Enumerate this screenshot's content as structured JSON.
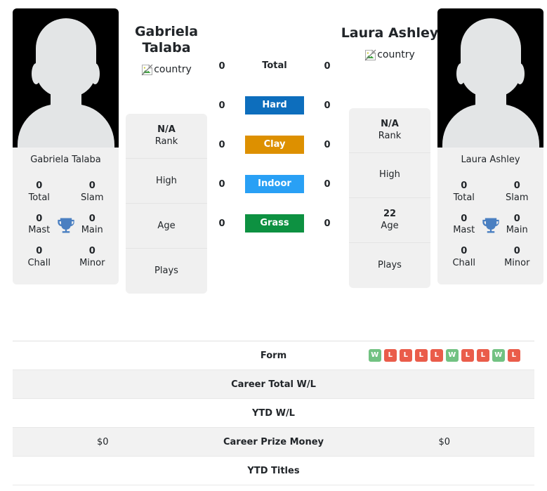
{
  "colors": {
    "hard": "#0d6ebd",
    "clay": "#dd9000",
    "indoor": "#29a0f5",
    "grass": "#0d9141",
    "win": "#72c282",
    "loss": "#ea5c4a",
    "trophy": "#4a7fc1",
    "card_bg": "#f0f0f0",
    "row_alt": "#f2f2f2"
  },
  "players": {
    "left": {
      "name_lines": [
        "Gabriela",
        "Talaba"
      ],
      "photo_caption": "Gabriela Talaba",
      "country_alt": "country",
      "titles": [
        {
          "value": "0",
          "label": "Total"
        },
        {
          "value": "0",
          "label": "Slam"
        },
        {
          "value": "0",
          "label": "Mast"
        },
        {
          "value": "0",
          "label": "Main"
        },
        {
          "value": "0",
          "label": "Chall"
        },
        {
          "value": "0",
          "label": "Minor"
        }
      ],
      "info": [
        {
          "value": "N/A",
          "label": "Rank"
        },
        {
          "value": "",
          "label": "High"
        },
        {
          "value": "",
          "label": "Age"
        },
        {
          "value": "",
          "label": "Plays"
        }
      ]
    },
    "right": {
      "name_lines": [
        "Laura Ashley"
      ],
      "photo_caption": "Laura Ashley",
      "country_alt": "country",
      "titles": [
        {
          "value": "0",
          "label": "Total"
        },
        {
          "value": "0",
          "label": "Slam"
        },
        {
          "value": "0",
          "label": "Mast"
        },
        {
          "value": "0",
          "label": "Main"
        },
        {
          "value": "0",
          "label": "Chall"
        },
        {
          "value": "0",
          "label": "Minor"
        }
      ],
      "info": [
        {
          "value": "N/A",
          "label": "Rank"
        },
        {
          "value": "",
          "label": "High"
        },
        {
          "value": "22",
          "label": "Age"
        },
        {
          "value": "",
          "label": "Plays"
        }
      ]
    }
  },
  "surfaces": [
    {
      "label": "Total",
      "left": "0",
      "right": "0",
      "plain": true
    },
    {
      "label": "Hard",
      "left": "0",
      "right": "0",
      "plain": false
    },
    {
      "label": "Clay",
      "left": "0",
      "right": "0",
      "plain": false
    },
    {
      "label": "Indoor",
      "left": "0",
      "right": "0",
      "plain": false
    },
    {
      "label": "Grass",
      "left": "0",
      "right": "0",
      "plain": false
    }
  ],
  "table": [
    {
      "label": "Form",
      "left": "",
      "right": "",
      "alt": false,
      "right_form": [
        "W",
        "L",
        "L",
        "L",
        "L",
        "W",
        "L",
        "L",
        "W",
        "L"
      ]
    },
    {
      "label": "Career Total W/L",
      "left": "",
      "right": "",
      "alt": true
    },
    {
      "label": "YTD W/L",
      "left": "",
      "right": "",
      "alt": false
    },
    {
      "label": "Career Prize Money",
      "left": "$0",
      "right": "$0",
      "alt": true
    },
    {
      "label": "YTD Titles",
      "left": "",
      "right": "",
      "alt": false
    }
  ]
}
